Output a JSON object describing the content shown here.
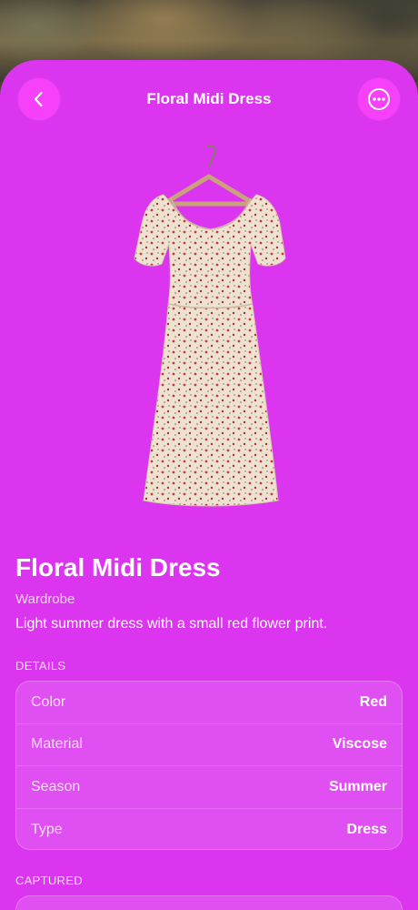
{
  "nav": {
    "title": "Floral Midi Dress",
    "back_icon": "chevron-left-icon",
    "more_icon": "ellipsis-circle-icon"
  },
  "product": {
    "image": "floral-dress-on-hanger",
    "title": "Floral Midi Dress",
    "category": "Wardrobe",
    "description": "Light summer dress with a small red flower print."
  },
  "details": {
    "label": "DETAILS",
    "rows": [
      {
        "label": "Color",
        "value": "Red"
      },
      {
        "label": "Material",
        "value": "Viscose"
      },
      {
        "label": "Season",
        "value": "Summer"
      },
      {
        "label": "Type",
        "value": "Dress"
      }
    ]
  },
  "captured": {
    "label": "CAPTURED"
  },
  "colors": {
    "sheet": "#dc35ef",
    "button": "#f640f9",
    "text": "#ffffff"
  }
}
